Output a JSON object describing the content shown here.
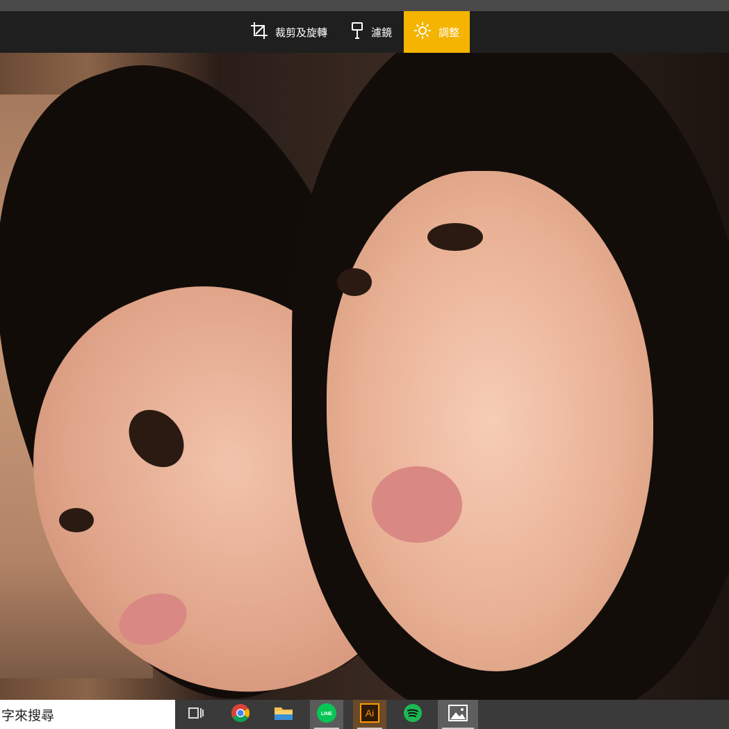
{
  "toolbar": {
    "tools": [
      {
        "label": "裁剪及旋轉",
        "icon": "crop-rotate-icon"
      },
      {
        "label": "濾鏡",
        "icon": "filter-brush-icon"
      },
      {
        "label": "調整",
        "icon": "brightness-sun-icon",
        "active": true
      }
    ],
    "accent_color": "#f5b400"
  },
  "taskbar": {
    "search_text": "字來搜尋",
    "apps": [
      {
        "icon": "task-view-icon"
      },
      {
        "icon": "chrome-icon"
      },
      {
        "icon": "file-explorer-icon"
      },
      {
        "icon": "line-icon",
        "label": "LINE"
      },
      {
        "icon": "illustrator-icon",
        "label": "Ai"
      },
      {
        "icon": "spotify-icon"
      },
      {
        "icon": "photos-icon"
      }
    ]
  }
}
